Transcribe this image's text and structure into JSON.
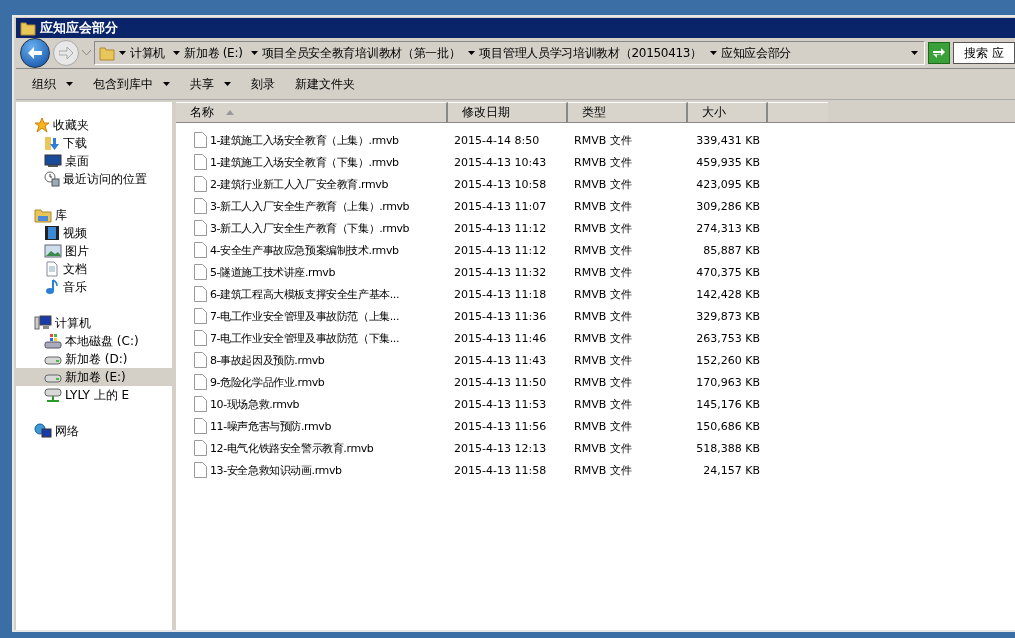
{
  "window": {
    "title": "应知应会部分"
  },
  "address": {
    "segments": [
      "计算机",
      "新加卷 (E:)",
      "项目全员安全教育培训教材（第一批）",
      "项目管理人员学习培训教材（20150413）",
      "应知应会部分"
    ]
  },
  "search": {
    "placeholder": "搜索 应"
  },
  "toolbar": {
    "buttons": [
      {
        "label": "组织",
        "has_menu": true
      },
      {
        "label": "包含到库中",
        "has_menu": true
      },
      {
        "label": "共享",
        "has_menu": true
      },
      {
        "label": "刻录",
        "has_menu": false
      },
      {
        "label": "新建文件夹",
        "has_menu": false
      }
    ]
  },
  "sidebar": {
    "groups": [
      {
        "label": "收藏夹",
        "kind": "favorites",
        "children": [
          {
            "label": "下载",
            "kind": "downloads",
            "selected": false
          },
          {
            "label": "桌面",
            "kind": "desktop",
            "selected": false
          },
          {
            "label": "最近访问的位置",
            "kind": "recent",
            "selected": false
          }
        ]
      },
      {
        "label": "库",
        "kind": "library",
        "children": [
          {
            "label": "视频",
            "kind": "videos",
            "selected": false
          },
          {
            "label": "图片",
            "kind": "pictures",
            "selected": false
          },
          {
            "label": "文档",
            "kind": "documents",
            "selected": false
          },
          {
            "label": "音乐",
            "kind": "music",
            "selected": false
          }
        ]
      },
      {
        "label": "计算机",
        "kind": "computer",
        "children": [
          {
            "label": "本地磁盘 (C:)",
            "kind": "system-drive",
            "selected": false
          },
          {
            "label": "新加卷 (D:)",
            "kind": "drive",
            "selected": false
          },
          {
            "label": "新加卷 (E:)",
            "kind": "drive",
            "selected": true
          },
          {
            "label": "LYLY 上的 E",
            "kind": "network-drive",
            "selected": false
          }
        ]
      },
      {
        "label": "网络",
        "kind": "network"
      }
    ]
  },
  "table": {
    "columns": [
      {
        "label": "名称",
        "sorted": true
      },
      {
        "label": "修改日期",
        "sorted": false
      },
      {
        "label": "类型",
        "sorted": false
      },
      {
        "label": "大小",
        "sorted": false
      }
    ],
    "rows": [
      {
        "name": "1-建筑施工入场安全教育（上集）.rmvb",
        "modified": "2015-4-14 8:50",
        "type": "RMVB 文件",
        "size": "339,431 KB"
      },
      {
        "name": "1-建筑施工入场安全教育（下集）.rmvb",
        "modified": "2015-4-13 10:43",
        "type": "RMVB 文件",
        "size": "459,935 KB"
      },
      {
        "name": "2-建筑行业新工人入厂安全教育.rmvb",
        "modified": "2015-4-13 10:58",
        "type": "RMVB 文件",
        "size": "423,095 KB"
      },
      {
        "name": "3-新工人入厂安全生产教育（上集）.rmvb",
        "modified": "2015-4-13 11:07",
        "type": "RMVB 文件",
        "size": "309,286 KB"
      },
      {
        "name": "3-新工人入厂安全生产教育（下集）.rmvb",
        "modified": "2015-4-13 11:12",
        "type": "RMVB 文件",
        "size": "274,313 KB"
      },
      {
        "name": "4-安全生产事故应急预案编制技术.rmvb",
        "modified": "2015-4-13 11:12",
        "type": "RMVB 文件",
        "size": "85,887 KB"
      },
      {
        "name": "5-隧道施工技术讲座.rmvb",
        "modified": "2015-4-13 11:32",
        "type": "RMVB 文件",
        "size": "470,375 KB"
      },
      {
        "name": "6-建筑工程高大模板支撑安全生产基本...",
        "modified": "2015-4-13 11:18",
        "type": "RMVB 文件",
        "size": "142,428 KB"
      },
      {
        "name": "7-电工作业安全管理及事故防范（上集...",
        "modified": "2015-4-13 11:36",
        "type": "RMVB 文件",
        "size": "329,873 KB"
      },
      {
        "name": "7-电工作业安全管理及事故防范（下集...",
        "modified": "2015-4-13 11:46",
        "type": "RMVB 文件",
        "size": "263,753 KB"
      },
      {
        "name": "8-事故起因及预防.rmvb",
        "modified": "2015-4-13 11:43",
        "type": "RMVB 文件",
        "size": "152,260 KB"
      },
      {
        "name": "9-危险化学品作业.rmvb",
        "modified": "2015-4-13 11:50",
        "type": "RMVB 文件",
        "size": "170,963 KB"
      },
      {
        "name": "10-现场急救.rmvb",
        "modified": "2015-4-13 11:53",
        "type": "RMVB 文件",
        "size": "145,176 KB"
      },
      {
        "name": "11-噪声危害与预防.rmvb",
        "modified": "2015-4-13 11:56",
        "type": "RMVB 文件",
        "size": "150,686 KB"
      },
      {
        "name": "12-电气化铁路安全警示教育.rmvb",
        "modified": "2015-4-13 12:13",
        "type": "RMVB 文件",
        "size": "518,388 KB"
      },
      {
        "name": "13-安全急救知识动画.rmvb",
        "modified": "2015-4-13 11:58",
        "type": "RMVB 文件",
        "size": "24,157 KB"
      }
    ]
  }
}
